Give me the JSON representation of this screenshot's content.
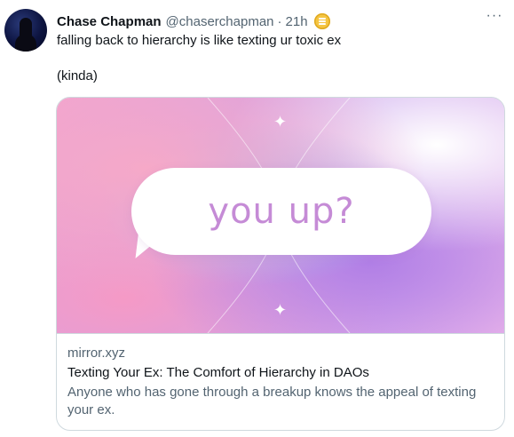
{
  "tweet": {
    "author_name": "Chase Chapman",
    "handle": "@chaserchapman",
    "separator": "·",
    "time": "21h",
    "text_line1": "falling back to hierarchy is like texting ur toxic ex",
    "text_line2": "(kinda)",
    "more_label": "···"
  },
  "card": {
    "image_text": "you up?",
    "domain": "mirror.xyz",
    "title": "Texting Your Ex: The Comfort of Hierarchy in DAOs",
    "description": "Anyone who has gone through a breakup knows the appeal of texting your ex."
  },
  "icons": {
    "avatar": "avatar",
    "badge": "emoji-badge-icon",
    "more": "more-options-icon",
    "sparkle": "sparkle-icon"
  },
  "colors": {
    "text": "#0f1419",
    "secondary": "#536471",
    "border": "#cfd9de",
    "bubble_text": "#c58bd6"
  }
}
